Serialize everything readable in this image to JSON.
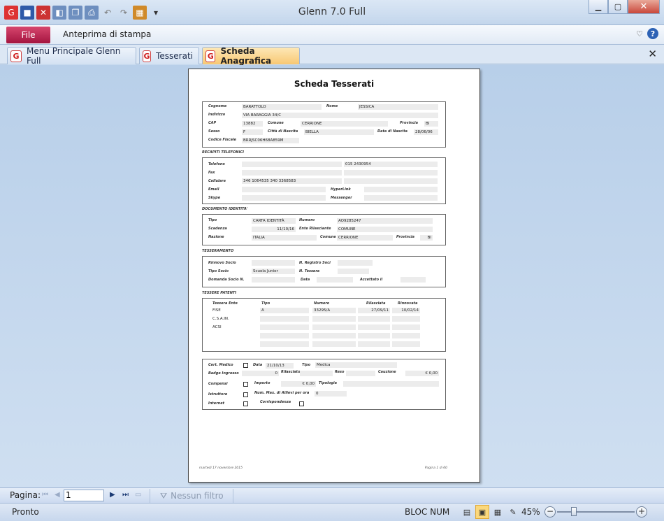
{
  "window": {
    "title": "Glenn 7.0 Full"
  },
  "ribbon": {
    "file_label": "File",
    "preview_tab": "Anteprima di stampa"
  },
  "doc_tabs": [
    "Menu Principale Glenn Full",
    "Tesserati",
    "Scheda Anagrafica"
  ],
  "report": {
    "title": "Scheda Tesserati",
    "anagrafica": {
      "cognome_label": "Cognome",
      "cognome": "BARATTOLO",
      "nome_label": "Nome",
      "nome": "JESSICA",
      "indirizzo_label": "Indirizzo",
      "indirizzo": "VIA BARAGGIA 34/C",
      "cap_label": "CAP",
      "cap": "13882",
      "comune_label": "Comune",
      "comune": "CERRIONE",
      "provincia_label": "Provincia",
      "provincia": "BI",
      "sesso_label": "Sesso",
      "sesso": "F",
      "citta_nascita_label": "Città di Nascita",
      "citta_nascita": "BIELLA",
      "data_nascita_label": "Data di Nascita",
      "data_nascita": "28/06/06",
      "codice_fiscale_label": "Codice Fiscale",
      "codice_fiscale": "BRRJSC06H68A859M"
    },
    "recapiti": {
      "section": "RECAPITI TELEFONICI",
      "telefono_label": "Telefono",
      "telefono": "015 2430954",
      "fax_label": "Fax",
      "cellulare_label": "Cellulare",
      "cellulare": "346 1064535 340 3368583",
      "email_label": "Email",
      "hyperlink_label": "HyperLink",
      "skype_label": "Skype",
      "messenger_label": "Messenger"
    },
    "documento": {
      "section": "DOCUMENTO IDENTITA'",
      "tipo_label": "Tipo",
      "tipo": "CARTA IDENTITÀ",
      "numero_label": "Numero",
      "numero": "AO9285247",
      "scadenza_label": "Scadenza",
      "scadenza": "11/10/16",
      "ente_label": "Ente Rilasciante",
      "ente": "COMUNE",
      "nazione_label": "Nazione",
      "nazione": "ITALIA",
      "comune_label": "Comune",
      "comune": "CERRIONE",
      "provincia_label": "Provincia",
      "provincia": "BI"
    },
    "tesseramento": {
      "section": "TESSERAMENTO",
      "rinnovo_label": "Rinnovo Socio",
      "n_registro_label": "N. Registro Soci",
      "tipo_socio_label": "Tipo Socio",
      "tipo_socio": "Scuola Junior",
      "n_tessera_label": "N. Tessera",
      "domanda_label": "Domanda Socio N.",
      "data_label": "Data",
      "accettato_label": "Accettato il"
    },
    "patenti": {
      "section": "TESSERE PATENTI",
      "headers": [
        "Tessera Ente",
        "Tipo",
        "Numero",
        "Rilasciata",
        "Rinnovata"
      ],
      "rows": [
        {
          "ente": "FISE",
          "tipo": "A",
          "numero": "33295/A",
          "rilasciata": "27/09/11",
          "rinnovata": "10/02/14"
        },
        {
          "ente": "C.S.A.IN.",
          "tipo": "",
          "numero": "",
          "rilasciata": "",
          "rinnovata": ""
        },
        {
          "ente": "ACSI",
          "tipo": "",
          "numero": "",
          "rilasciata": "",
          "rinnovata": ""
        }
      ]
    },
    "medico": {
      "cert_label": "Cert. Medico",
      "data_label": "Data",
      "data": "21/10/13",
      "tipo_label": "Tipo",
      "tipo": "Medica",
      "badge_label": "Badge Ingresso",
      "badge": "0",
      "rilasciato_label": "Rilasciato",
      "reso_label": "Reso",
      "cauzione_label": "Cauzione",
      "cauzione": "€ 0,00",
      "compensi_label": "Compensi",
      "importo_label": "Importo",
      "importo": "€ 0,00",
      "tipologia_label": "Tipologia",
      "istruttore_label": "Istruttore",
      "allievi_label": "Num. Max. di Allievi per ora",
      "allievi": "0",
      "internet_label": "Internet",
      "corrispondenza_label": "Corrispondenza"
    },
    "footer_left": "martedì 17 novembre 2015",
    "footer_right": "Pagina 1 di 60"
  },
  "navbar": {
    "label": "Pagina:",
    "page_value": "1",
    "filter": "Nessun filtro"
  },
  "status": {
    "text": "Pronto",
    "bloc": "BLOC NUM",
    "zoom": "45%"
  },
  "colors": {
    "file_tab": "#b5204d",
    "active_tab": "#f8c873",
    "canvas": "#c6d9ee"
  }
}
